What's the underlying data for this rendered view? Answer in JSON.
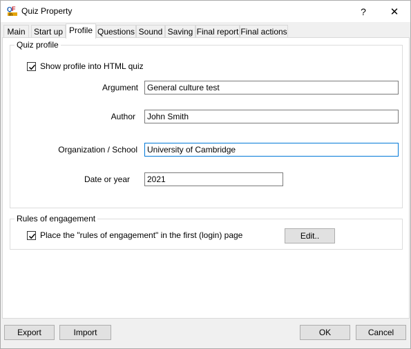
{
  "window": {
    "title": "Quiz Property"
  },
  "titlebar": {
    "help": "?",
    "close": "✕"
  },
  "tabs": [
    "Main",
    "Start up",
    "Profile",
    "Questions",
    "Sound",
    "Saving",
    "Final report",
    "Final actions"
  ],
  "active_tab": "Profile",
  "quiz_profile": {
    "group_label": "Quiz profile",
    "show_profile_label": "Show profile into HTML quiz",
    "show_profile_checked": true,
    "argument_label": "Argument",
    "argument_value": "General culture test",
    "author_label": "Author",
    "author_value": "John Smith",
    "organization_label": "Organization / School",
    "organization_value": "University of Cambridge",
    "date_label": "Date or year",
    "date_value": "2021"
  },
  "rules": {
    "group_label": "Rules of engagement",
    "place_label": "Place the \"rules of engagement\" in the first (login) page",
    "place_checked": true,
    "edit_button": "Edit.."
  },
  "footer": {
    "export": "Export",
    "import": "Import",
    "ok": "OK",
    "cancel": "Cancel"
  }
}
